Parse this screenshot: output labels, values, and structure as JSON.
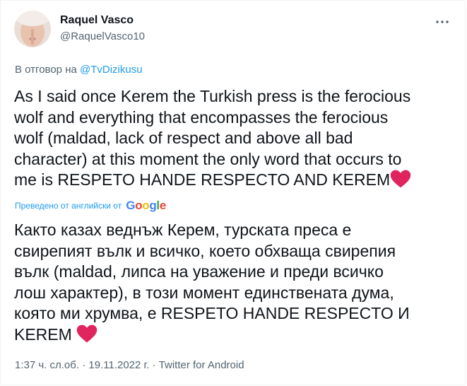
{
  "user": {
    "name": "Raquel Vasco",
    "handle": "@RaquelVasco10"
  },
  "reply": {
    "prefix": "В отговор на",
    "mention": "@TvDizikusu"
  },
  "tweet": {
    "original_lines": [
      "As I said once Kerem the Turkish press is the ferocious",
      "wolf and everything that encompasses the ferocious",
      "wolf (maldad, lack of respect and above all bad",
      "character) at this moment the only word that occurs to",
      "me is RESPETO HANDE RESPECTO AND KEREM"
    ],
    "translation_label": "Преведено от английски от",
    "translation_provider": "Google",
    "translated_lines": [
      "Както казах веднъж Керем, турската преса е",
      "свирепият вълк и всичко, което обхваща свирепия",
      "вълк (maldad, липса на уважение и преди всичко",
      "лош характер), в този момент единствената дума,",
      "която ми хрумва, е RESPETO HANDE RESPECTO И",
      "KEREM"
    ]
  },
  "footer": {
    "time": "1:37 ч. сл.об.",
    "separator": "·",
    "date": "19.11.2022 г.",
    "source": "Twitter for Android"
  },
  "icons": {
    "more": "more-dots-icon",
    "heart": "red-heart-icon",
    "avatar": "profile-avatar"
  },
  "colors": {
    "link": "#1d9bf0",
    "secondary": "#536471",
    "heart": "#e0245e"
  }
}
